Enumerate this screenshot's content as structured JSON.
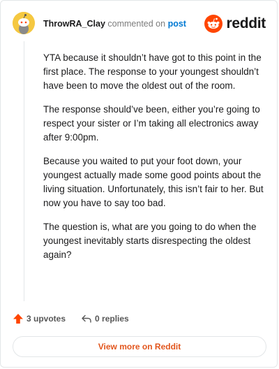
{
  "comment": {
    "username": "ThrowRA_Clay",
    "commented_on_text": "commented on",
    "post_link": "post",
    "paragraphs": [
      "YTA because it shouldn’t have got to this point in the first place. The response to your youngest shouldn’t have been to move the oldest out of the room.",
      "The response should’ve been, either you’re going to respect your sister or I’m taking all electronics away after 9:00pm.",
      "Because you waited to put your foot down, your youngest actually made some good points about the living situation. Unfortunately, this isn’t fair to her. But now you have to say too bad.",
      "The question is, what are you going to do when the youngest inevitably starts disrespecting the oldest again?"
    ]
  },
  "brand": {
    "wordmark": "reddit",
    "color": "#ff4500"
  },
  "actions": {
    "upvotes": "3 upvotes",
    "replies": "0 replies",
    "upvote_icon": "upvote-arrow-icon",
    "reply_icon": "reply-arrow-icon"
  },
  "footer": {
    "view_more": "View more on Reddit"
  },
  "colors": {
    "link": "#0079d3",
    "accent": "#ff4500",
    "button_text": "#e2561d"
  }
}
